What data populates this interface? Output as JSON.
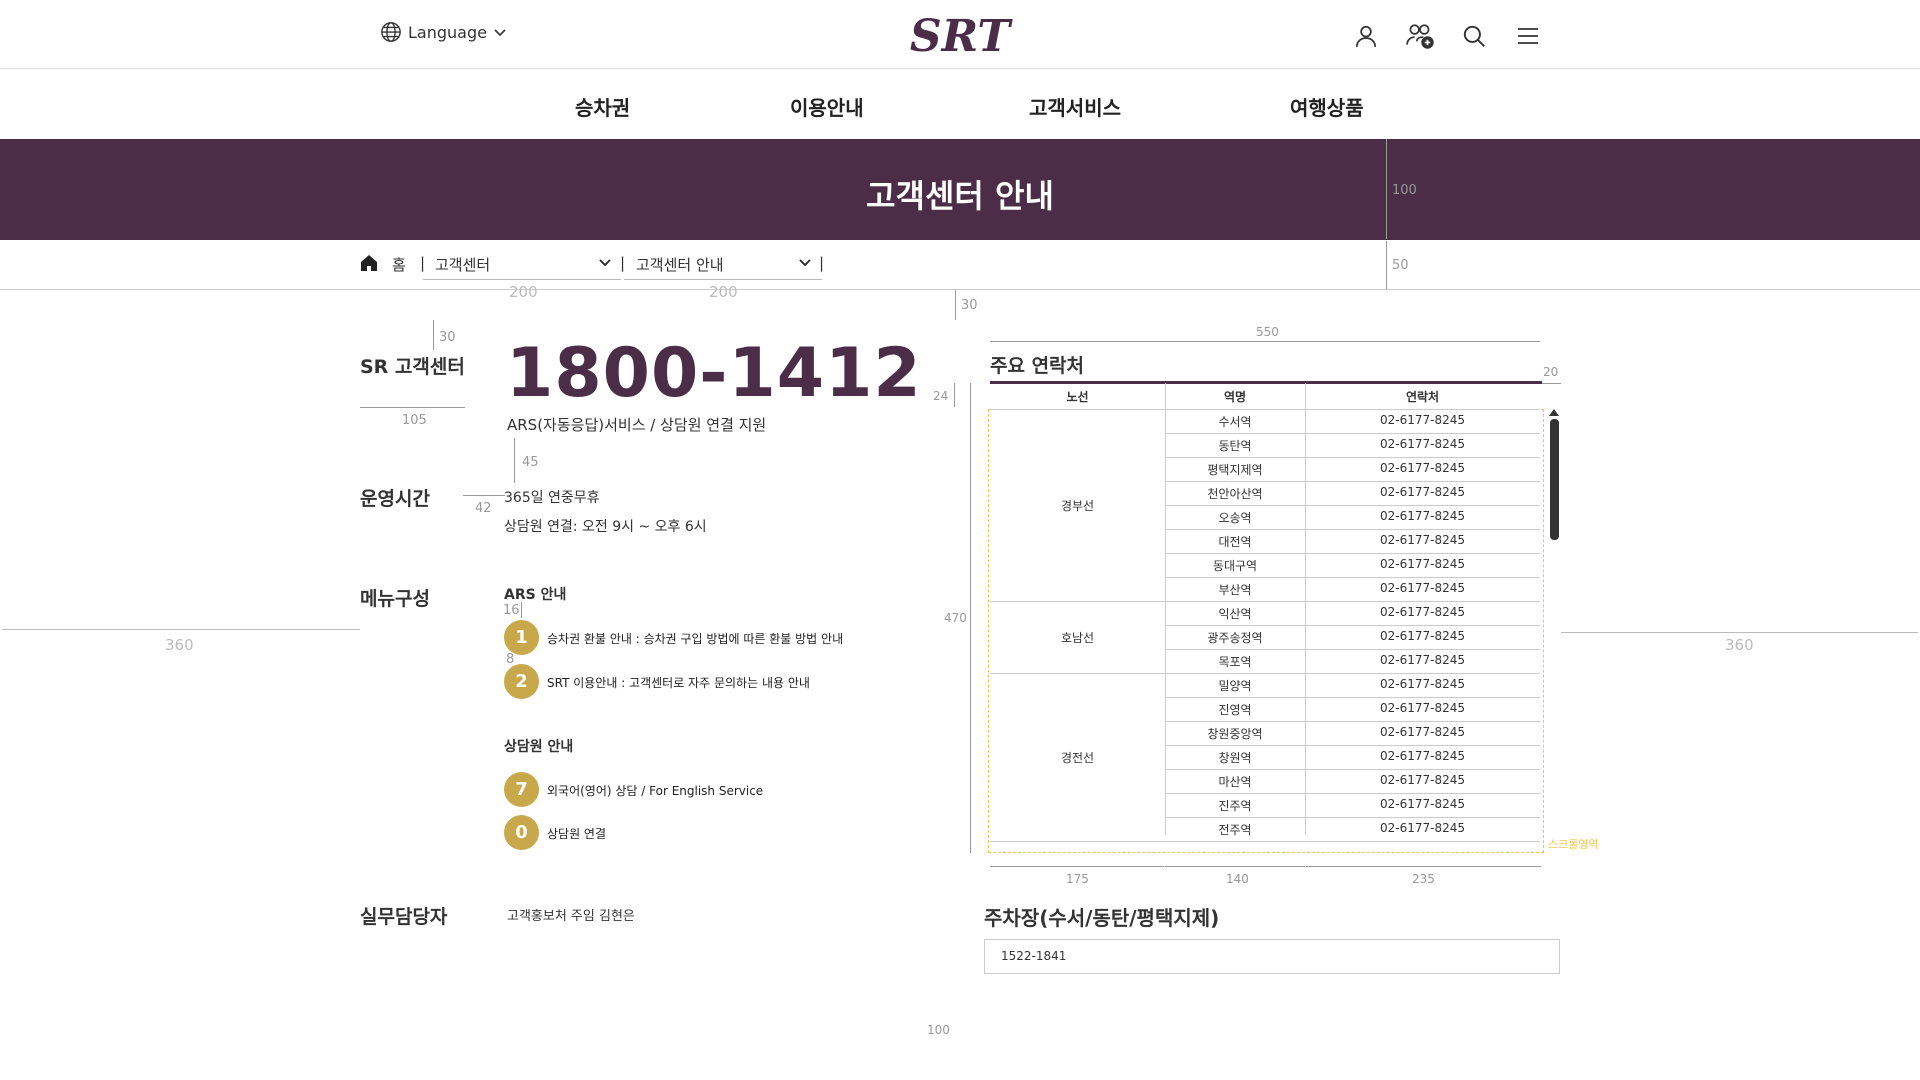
{
  "header": {
    "language_label": "Language",
    "logo_text": "SRT"
  },
  "gnb": {
    "items": [
      "승차권",
      "이용안내",
      "고객서비스",
      "여행상품"
    ]
  },
  "banner": {
    "title": "고객센터 안내"
  },
  "breadcrumb": {
    "home": "홈",
    "sep": "|",
    "level1": "고객센터",
    "level2": "고객센터 안내"
  },
  "measures": {
    "banner_h": "100",
    "crumb_h": "50",
    "sel1_w": "200",
    "sel2_w": "200",
    "gap30a": "30",
    "gap30b": "30",
    "label_w": "105",
    "gap45": "45",
    "gap42": "42",
    "gap16": "16",
    "gap8": "8",
    "margin_l": "360",
    "margin_r": "360",
    "tbl_w": "550",
    "tbl_gap20": "20",
    "th_h": "24",
    "tbl_h": "470",
    "col1": "175",
    "col2": "140",
    "col3": "235",
    "bottom": "100",
    "scroll_area": "스크롤영역"
  },
  "customer_center": {
    "title": "SR 고객센터",
    "phone": "1800-1412",
    "phone_desc": "ARS(자동응답)서비스 / 상담원 연결 지원"
  },
  "hours": {
    "title": "운영시간",
    "line1": "365일 연중무휴",
    "line2": "상담원 연결: 오전 9시 ~ 오후 6시"
  },
  "menu": {
    "title": "메뉴구성",
    "ars_title": "ARS 안내",
    "ars_items": [
      {
        "num": "1",
        "text": "승차권 환불 안내 : 승차권 구입 방법에 따른 환불 방법 안내"
      },
      {
        "num": "2",
        "text": "SRT 이용안내 : 고객센터로 자주 문의하는 내용 안내"
      }
    ],
    "agent_title": "상담원 안내",
    "agent_items": [
      {
        "num": "7",
        "text": "외국어(영어) 상담 / For English Service"
      },
      {
        "num": "0",
        "text": "상담원 연결"
      }
    ]
  },
  "staff": {
    "title": "실무담당자",
    "name": "고객홍보처 주임 김현은"
  },
  "contacts": {
    "title": "주요 연락처",
    "headers": [
      "노선",
      "역명",
      "연락처"
    ],
    "groups": [
      {
        "line": "경부선",
        "stations": [
          {
            "name": "수서역",
            "tel": "02-6177-8245"
          },
          {
            "name": "동탄역",
            "tel": "02-6177-8245"
          },
          {
            "name": "평택지제역",
            "tel": "02-6177-8245"
          },
          {
            "name": "천안아산역",
            "tel": "02-6177-8245"
          },
          {
            "name": "오송역",
            "tel": "02-6177-8245"
          },
          {
            "name": "대전역",
            "tel": "02-6177-8245"
          },
          {
            "name": "동대구역",
            "tel": "02-6177-8245"
          },
          {
            "name": "부산역",
            "tel": "02-6177-8245"
          }
        ]
      },
      {
        "line": "호남선",
        "stations": [
          {
            "name": "익산역",
            "tel": "02-6177-8245"
          },
          {
            "name": "광주송정역",
            "tel": "02-6177-8245"
          },
          {
            "name": "목포역",
            "tel": "02-6177-8245"
          }
        ]
      },
      {
        "line": "경전선",
        "stations": [
          {
            "name": "밀양역",
            "tel": "02-6177-8245"
          },
          {
            "name": "진영역",
            "tel": "02-6177-8245"
          },
          {
            "name": "창원중앙역",
            "tel": "02-6177-8245"
          },
          {
            "name": "창원역",
            "tel": "02-6177-8245"
          },
          {
            "name": "마산역",
            "tel": "02-6177-8245"
          },
          {
            "name": "진주역",
            "tel": "02-6177-8245"
          },
          {
            "name": "전주역",
            "tel": "02-6177-8245"
          }
        ]
      }
    ]
  },
  "parking": {
    "title": "주차장(수서/동탄/평택지제)",
    "phone": "1522-1841"
  },
  "colors": {
    "brand": "#4b2d48",
    "accent": "#c9a84c",
    "scroll_area": "#f0c64a"
  }
}
